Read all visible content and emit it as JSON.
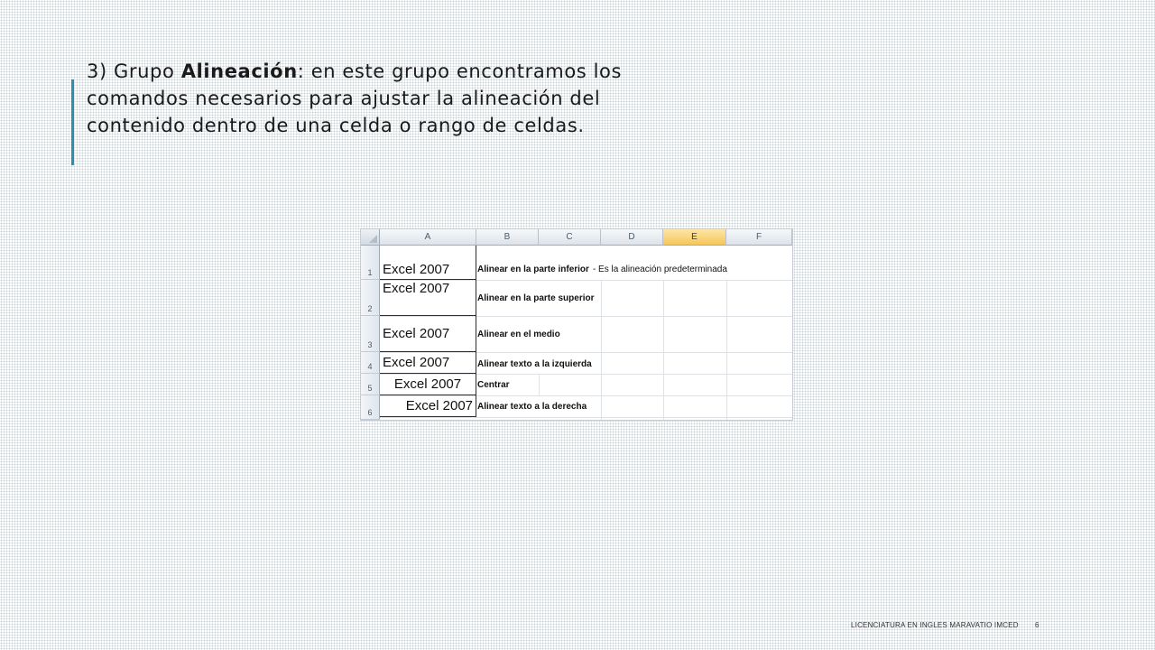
{
  "slide": {
    "text_prefix": "3) Grupo ",
    "text_bold": "Alineación",
    "text_suffix": ": en este grupo encontramos los comandos necesarios para ajustar la alineación del contenido dentro de una celda o rango de celdas."
  },
  "spreadsheet": {
    "columns": [
      "A",
      "B",
      "C",
      "D",
      "E",
      "F"
    ],
    "active_column": "E",
    "rows": [
      {
        "num": "1",
        "a": "Excel 2007",
        "b": "Alinear en la parte inferior",
        "b_note": "- Es la alineación predeterminada"
      },
      {
        "num": "2",
        "a": "Excel 2007",
        "b": "Alinear en la parte superior",
        "b_note": ""
      },
      {
        "num": "3",
        "a": "Excel 2007",
        "b": "Alinear en el medio",
        "b_note": ""
      },
      {
        "num": "4",
        "a": "Excel 2007",
        "b": "Alinear texto a la izquierda",
        "b_note": ""
      },
      {
        "num": "5",
        "a": "Excel 2007",
        "b": "Centrar",
        "b_note": ""
      },
      {
        "num": "6",
        "a": "Excel 2007",
        "b": "Alinear texto a la derecha",
        "b_note": ""
      }
    ]
  },
  "footer": {
    "text": "LICENCIATURA EN INGLES MARAVATIO IMCED",
    "page_number": "6"
  }
}
